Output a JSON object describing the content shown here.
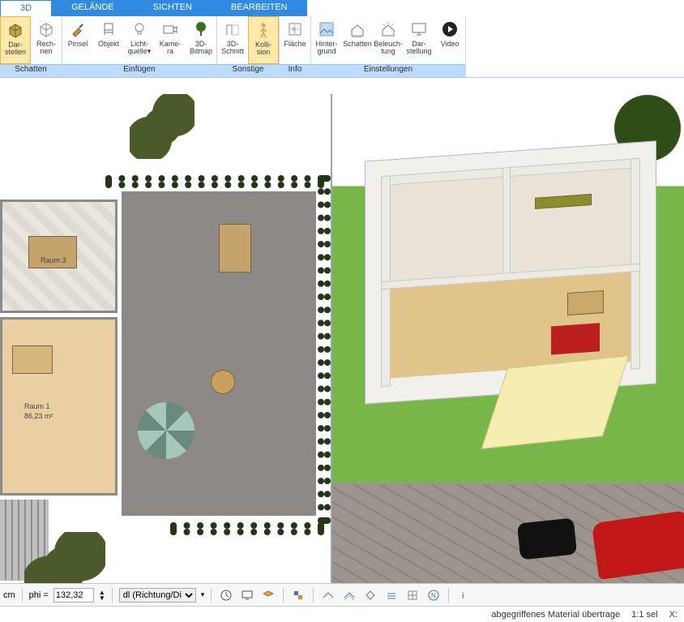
{
  "tabs": {
    "active": "3D",
    "items": [
      "3D",
      "GELÄNDE",
      "SICHTEN",
      "BEARBEITEN"
    ]
  },
  "ribbon": {
    "groups": [
      {
        "label": "Schatten",
        "buttons": [
          {
            "id": "darstellen",
            "line1": "Dar-",
            "line2": "stellen",
            "icon": "cube",
            "selected": true
          },
          {
            "id": "rechnen",
            "line1": "Rech-",
            "line2": "nen",
            "icon": "cube-wire"
          }
        ]
      },
      {
        "label": "Einfügen",
        "buttons": [
          {
            "id": "pinsel",
            "line1": "Pinsel",
            "line2": "",
            "icon": "brush"
          },
          {
            "id": "objekt",
            "line1": "Objekt",
            "line2": "",
            "icon": "chair"
          },
          {
            "id": "lichtquelle",
            "line1": "Licht-",
            "line2": "quelle▾",
            "icon": "bulb"
          },
          {
            "id": "kamera",
            "line1": "Kame-",
            "line2": "ra",
            "icon": "camera"
          },
          {
            "id": "3dbitmap",
            "line1": "3D-",
            "line2": "Bitmap",
            "icon": "tree"
          }
        ]
      },
      {
        "label": "Sonstige",
        "buttons": [
          {
            "id": "3dschnitt",
            "line1": "3D-",
            "line2": "Schnitt",
            "icon": "section"
          },
          {
            "id": "kollision",
            "line1": "Kolli-",
            "line2": "sion",
            "icon": "person",
            "selected": true
          }
        ]
      },
      {
        "label": "Info",
        "buttons": [
          {
            "id": "flaeche",
            "line1": "Fläche",
            "line2": "",
            "icon": "area"
          }
        ]
      },
      {
        "label": "Einstellungen",
        "buttons": [
          {
            "id": "hintergrund",
            "line1": "Hinter-",
            "line2": "grund",
            "icon": "bg"
          },
          {
            "id": "schatten2",
            "line1": "Schatten",
            "line2": "",
            "icon": "house-shadow"
          },
          {
            "id": "beleuchtung",
            "line1": "Beleuch-",
            "line2": "tung",
            "icon": "house-light"
          },
          {
            "id": "darstellung",
            "line1": "Dar-",
            "line2": "stellung",
            "icon": "monitor"
          },
          {
            "id": "video",
            "line1": "Video",
            "line2": "",
            "icon": "play"
          }
        ]
      }
    ]
  },
  "plan": {
    "room1_label": "Raum 1",
    "room1_area": "86,23 m²",
    "room2_label": "Raum 3"
  },
  "bottom": {
    "unit": "cm",
    "phi_label": "phi =",
    "phi_value": "132,32",
    "mode_select": "dl (Richtung/Di"
  },
  "status": {
    "msg": "abgegriffenes Material übertrage",
    "sel": "1:1 sel",
    "x": "X:"
  }
}
